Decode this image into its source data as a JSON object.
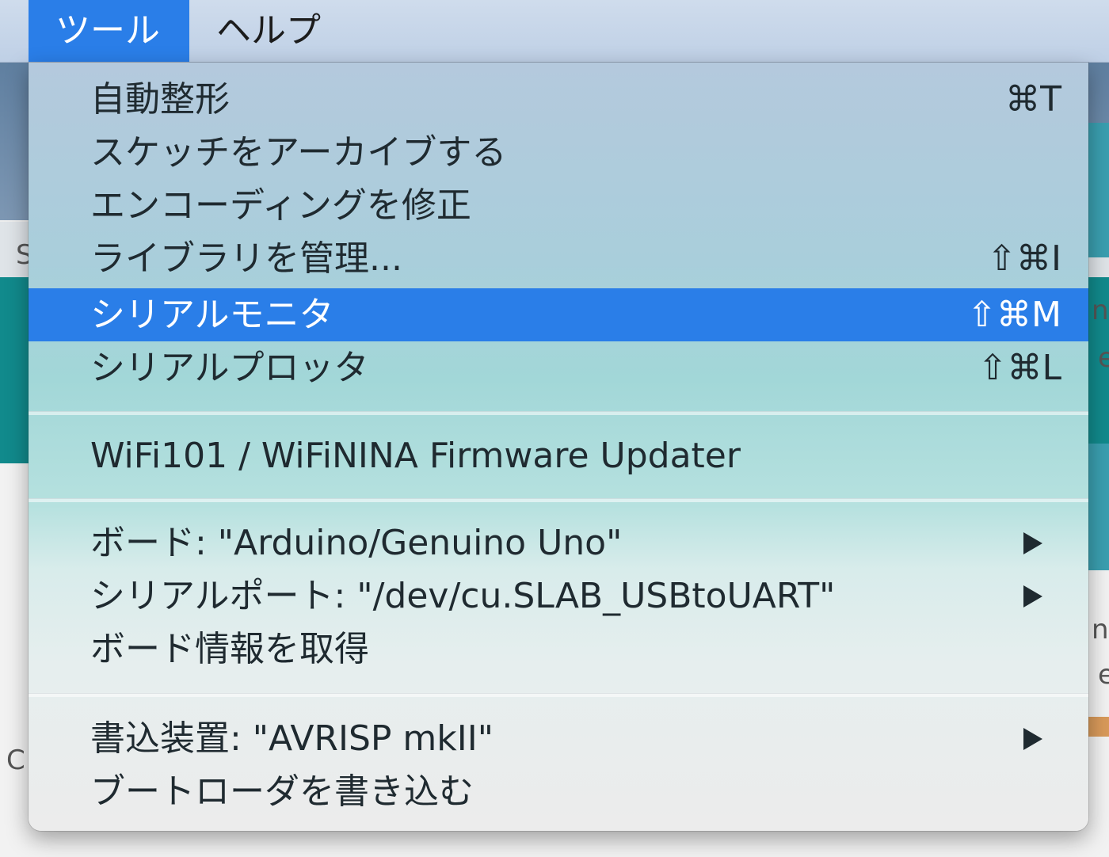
{
  "menubar": {
    "items": [
      {
        "label": "ツール"
      },
      {
        "label": "ヘルプ"
      }
    ]
  },
  "menu": {
    "items": [
      {
        "label": "自動整形",
        "shortcut": "⌘T"
      },
      {
        "label": "スケッチをアーカイブする",
        "shortcut": ""
      },
      {
        "label": "エンコーディングを修正",
        "shortcut": ""
      },
      {
        "label": "ライブラリを管理...",
        "shortcut": "⇧⌘I"
      },
      {
        "label": "シリアルモニタ",
        "shortcut": "⇧⌘M"
      },
      {
        "label": "シリアルプロッタ",
        "shortcut": "⇧⌘L"
      },
      {
        "label": "WiFi101 / WiFiNINA Firmware Updater",
        "shortcut": ""
      },
      {
        "label": "ボード: \"Arduino/Genuino Uno\"",
        "shortcut": ""
      },
      {
        "label": "シリアルポート: \"/dev/cu.SLAB_USBtoUART\"",
        "shortcut": ""
      },
      {
        "label": "ボード情報を取得",
        "shortcut": ""
      },
      {
        "label": "書込装置: \"AVRISP mkII\"",
        "shortcut": ""
      },
      {
        "label": "ブートローダを書き込む",
        "shortcut": ""
      }
    ]
  },
  "background": {
    "left_letters": [
      "S",
      "C"
    ],
    "right_letters": [
      "n",
      "e",
      "n",
      "e"
    ]
  },
  "colors": {
    "selection": "#2a7ee8",
    "menubar": "#c7d6ea",
    "text": "#1f2a30"
  }
}
